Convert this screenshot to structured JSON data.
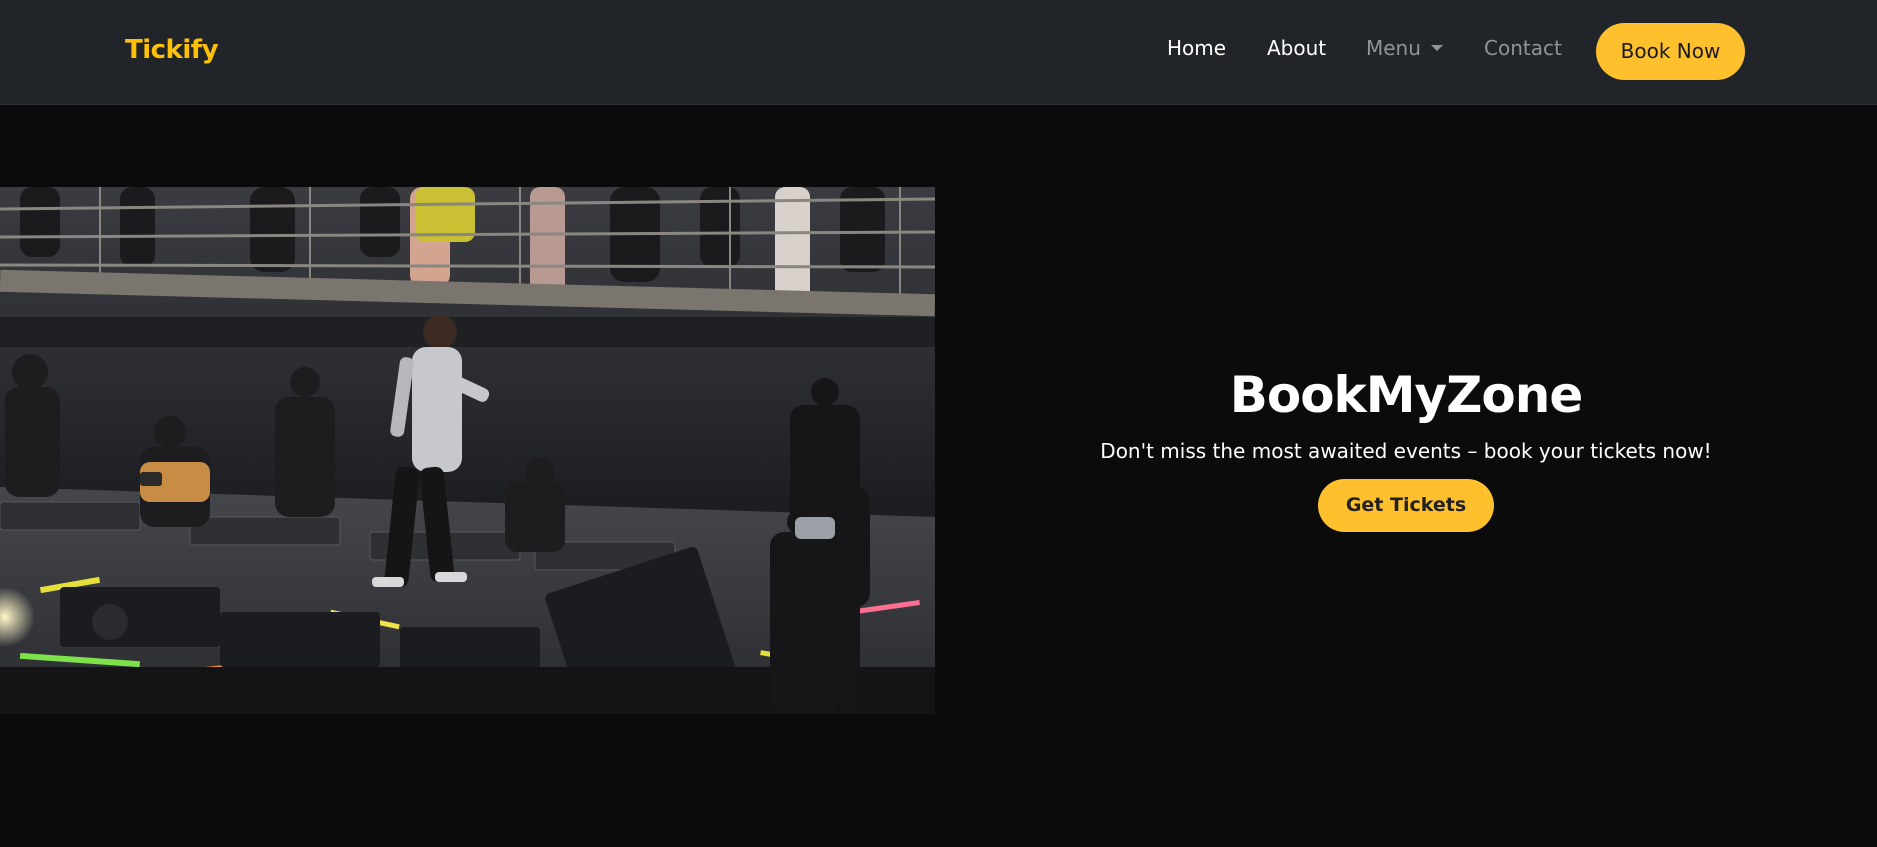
{
  "navbar": {
    "brand": "Tickify",
    "links": [
      {
        "label": "Home"
      },
      {
        "label": "About"
      },
      {
        "label": "Menu"
      },
      {
        "label": "Contact"
      }
    ],
    "cta_label": "Book Now"
  },
  "hero": {
    "title": "BookMyZone",
    "subtitle": "Don't miss the most awaited events – book your tickets now!",
    "button_label": "Get Tickets"
  },
  "colors": {
    "accent": "#ffc02e",
    "navbar_bg": "#212529",
    "page_bg": "#0b0b0c"
  }
}
